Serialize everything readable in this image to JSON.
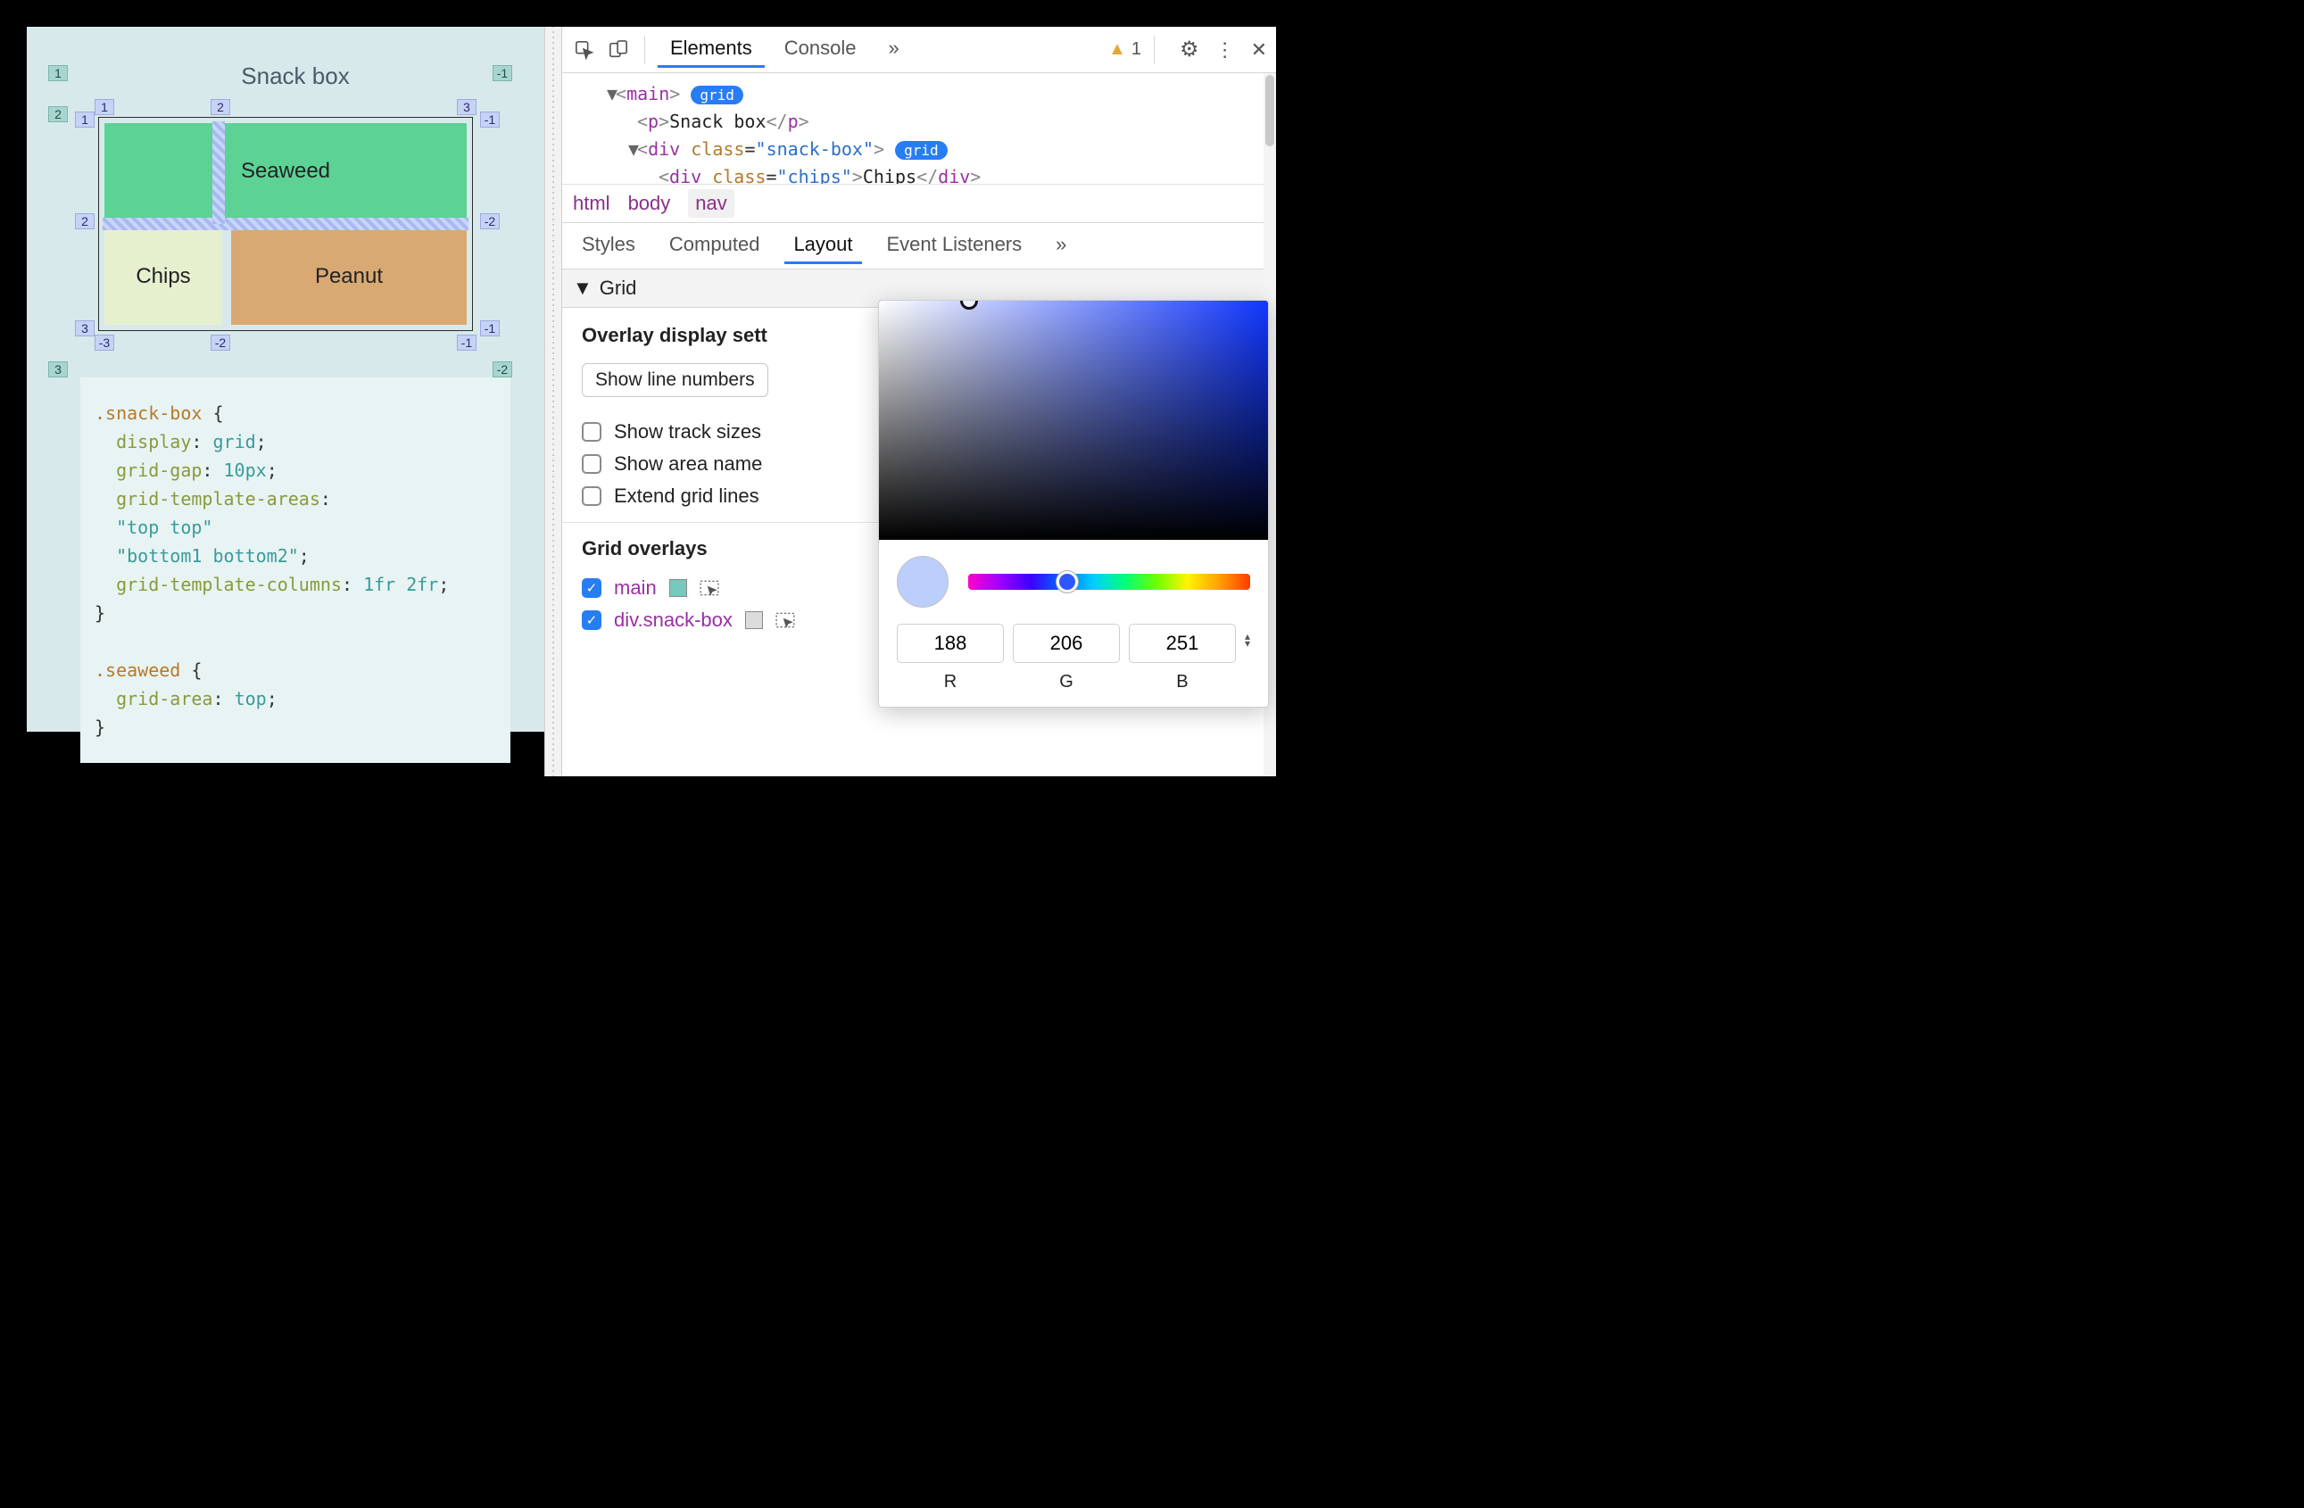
{
  "viewport": {
    "title": "Snack box",
    "cells": {
      "seaweed": "Seaweed",
      "chips": "Chips",
      "peanut": "Peanut"
    },
    "outerLines": {
      "l1": "1",
      "l2": "2",
      "l3": "3",
      "r1": "-1",
      "r2": "-2"
    },
    "gridLines": {
      "topRow": [
        "1",
        "2",
        "3"
      ],
      "left": [
        "1",
        "2",
        "3"
      ],
      "right": [
        "-1",
        "-2",
        "-1"
      ],
      "bottom": [
        "-3",
        "-2",
        "-1"
      ]
    },
    "code": ".snack-box {\n  display: grid;\n  grid-gap: 10px;\n  grid-template-areas:\n  \"top top\"\n  \"bottom1 bottom2\";\n  grid-template-columns: 1fr 2fr;\n}\n\n.seaweed {\n  grid-area: top;\n}"
  },
  "toolbar": {
    "tabs": [
      "Elements",
      "Console"
    ],
    "more": "»",
    "warningCount": "1"
  },
  "dom": {
    "l1_tag": "main",
    "pill": "grid",
    "l2_tag": "p",
    "l2_text": "Snack box",
    "l3_tag": "div",
    "l3_class": "snack-box",
    "l4_tag": "div",
    "l4_class": "chips",
    "l4_text": "Chips"
  },
  "breadcrumbs": [
    "html",
    "body",
    "nav"
  ],
  "subtabs": [
    "Styles",
    "Computed",
    "Layout",
    "Event Listeners"
  ],
  "subtabsMore": "»",
  "layout": {
    "section": "Grid",
    "overlayHead": "Overlay display sett",
    "dropdown": "Show line numbers",
    "checks": [
      "Show track sizes",
      "Show area name",
      "Extend grid lines"
    ],
    "overlaysHead": "Grid overlays",
    "overlays": [
      {
        "name": "main",
        "checked": true,
        "swatch": "#78c9bd"
      },
      {
        "name": "div.snack-box",
        "checked": true,
        "swatch": "#dcdcdc"
      }
    ]
  },
  "picker": {
    "r": "188",
    "g": "206",
    "b": "251",
    "labels": {
      "r": "R",
      "g": "G",
      "b": "B"
    }
  }
}
